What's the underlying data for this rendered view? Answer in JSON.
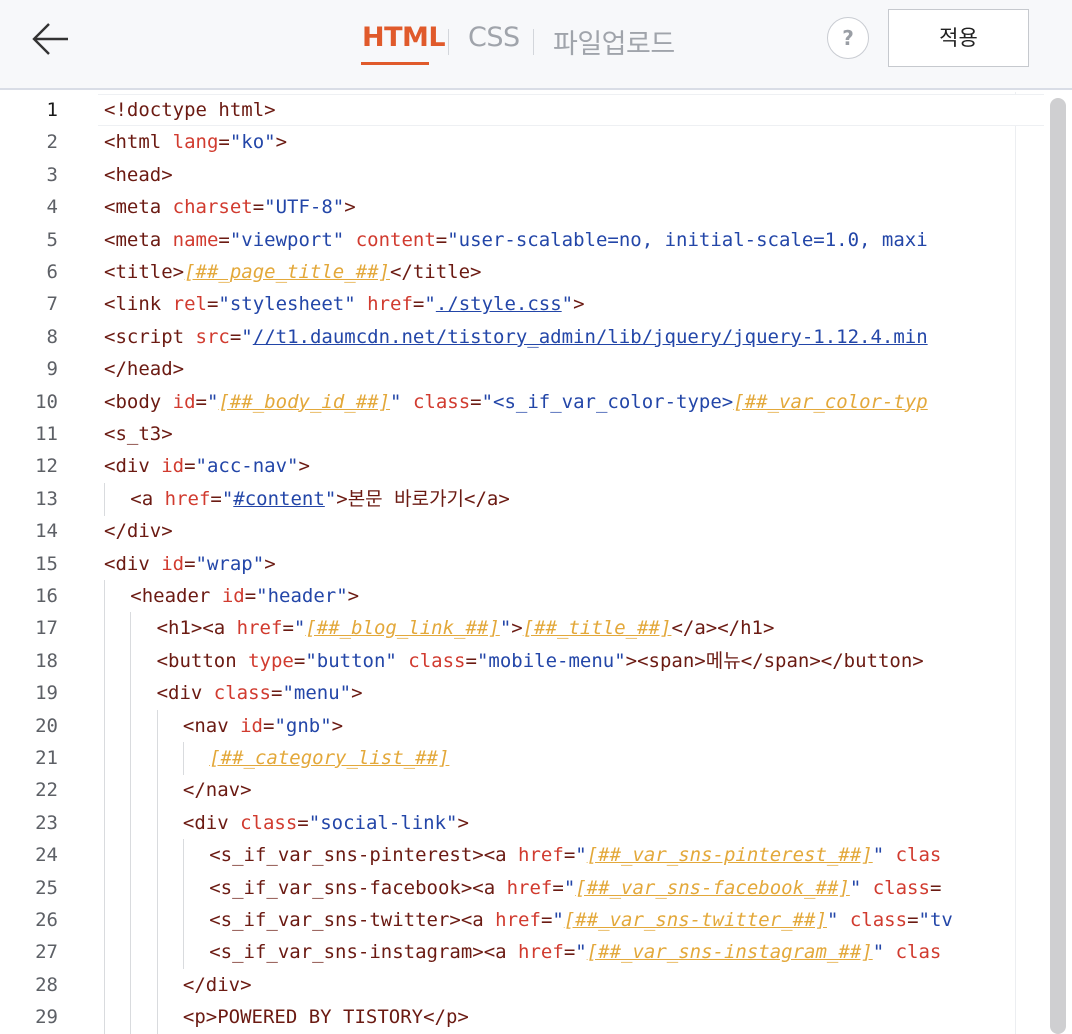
{
  "header": {
    "tabs": [
      {
        "label": "HTML",
        "active": true
      },
      {
        "label": "CSS",
        "active": false
      },
      {
        "label": "파일업로드",
        "active": false
      }
    ],
    "help_label": "?",
    "apply_label": "적용"
  },
  "colors": {
    "accent": "#e05a2b",
    "tag": "#6b1a12",
    "attr": "#d13b2f",
    "string": "#2346a8",
    "variable": "#e3a83a"
  },
  "editor": {
    "lines": [
      {
        "n": "1",
        "segs": [
          [
            "t",
            "<!doctype html>"
          ]
        ]
      },
      {
        "n": "2",
        "segs": [
          [
            "t",
            "<html "
          ],
          [
            "a",
            "lang"
          ],
          [
            "t",
            "="
          ],
          [
            "s",
            "\"ko\""
          ],
          [
            "t",
            ">"
          ]
        ]
      },
      {
        "n": "3",
        "segs": [
          [
            "t",
            "<head>"
          ]
        ]
      },
      {
        "n": "4",
        "segs": [
          [
            "t",
            "<meta "
          ],
          [
            "a",
            "charset"
          ],
          [
            "t",
            "="
          ],
          [
            "s",
            "\"UTF-8\""
          ],
          [
            "t",
            ">"
          ]
        ]
      },
      {
        "n": "5",
        "segs": [
          [
            "t",
            "<meta "
          ],
          [
            "a",
            "name"
          ],
          [
            "t",
            "="
          ],
          [
            "s",
            "\"viewport\""
          ],
          [
            "t",
            " "
          ],
          [
            "a",
            "content"
          ],
          [
            "t",
            "="
          ],
          [
            "s",
            "\"user-scalable=no, initial-scale=1.0, maxi"
          ]
        ]
      },
      {
        "n": "6",
        "segs": [
          [
            "t",
            "<title>"
          ],
          [
            "v",
            "[##_page_title_##]"
          ],
          [
            "t",
            "</title>"
          ]
        ]
      },
      {
        "n": "7",
        "segs": [
          [
            "t",
            "<link "
          ],
          [
            "a",
            "rel"
          ],
          [
            "t",
            "="
          ],
          [
            "s",
            "\"stylesheet\""
          ],
          [
            "t",
            " "
          ],
          [
            "a",
            "href"
          ],
          [
            "t",
            "="
          ],
          [
            "s",
            "\""
          ],
          [
            "lk",
            "./style.css"
          ],
          [
            "s",
            "\""
          ],
          [
            "t",
            ">"
          ]
        ]
      },
      {
        "n": "8",
        "segs": [
          [
            "t",
            "<script "
          ],
          [
            "a",
            "src"
          ],
          [
            "t",
            "="
          ],
          [
            "s",
            "\""
          ],
          [
            "lk",
            "//t1.daumcdn.net/tistory_admin/lib/jquery/jquery-1.12.4.min"
          ]
        ]
      },
      {
        "n": "9",
        "segs": [
          [
            "t",
            "</head>"
          ]
        ]
      },
      {
        "n": "10",
        "segs": [
          [
            "t",
            "<body "
          ],
          [
            "a",
            "id"
          ],
          [
            "t",
            "="
          ],
          [
            "s",
            "\""
          ],
          [
            "v",
            "[##_body_id_##]"
          ],
          [
            "s",
            "\""
          ],
          [
            "t",
            " "
          ],
          [
            "a",
            "class"
          ],
          [
            "t",
            "="
          ],
          [
            "s",
            "\"<s_if_var_color-type>"
          ],
          [
            "v",
            "[##_var_color-typ"
          ]
        ]
      },
      {
        "n": "11",
        "segs": [
          [
            "t",
            "<s_t3>"
          ]
        ]
      },
      {
        "n": "12",
        "segs": [
          [
            "t",
            "<div "
          ],
          [
            "a",
            "id"
          ],
          [
            "t",
            "="
          ],
          [
            "s",
            "\"acc-nav\""
          ],
          [
            "t",
            ">"
          ]
        ]
      },
      {
        "n": "13",
        "indent": 1,
        "segs": [
          [
            "t",
            "<a "
          ],
          [
            "a",
            "href"
          ],
          [
            "t",
            "="
          ],
          [
            "s",
            "\""
          ],
          [
            "lk",
            "#content"
          ],
          [
            "s",
            "\""
          ],
          [
            "t",
            ">본문 바로가기</a>"
          ]
        ]
      },
      {
        "n": "14",
        "segs": [
          [
            "t",
            "</div>"
          ]
        ]
      },
      {
        "n": "15",
        "segs": [
          [
            "t",
            "<div "
          ],
          [
            "a",
            "id"
          ],
          [
            "t",
            "="
          ],
          [
            "s",
            "\"wrap\""
          ],
          [
            "t",
            ">"
          ]
        ]
      },
      {
        "n": "16",
        "indent": 1,
        "segs": [
          [
            "t",
            "<header "
          ],
          [
            "a",
            "id"
          ],
          [
            "t",
            "="
          ],
          [
            "s",
            "\"header\""
          ],
          [
            "t",
            ">"
          ]
        ]
      },
      {
        "n": "17",
        "indent": 2,
        "segs": [
          [
            "t",
            "<h1><a "
          ],
          [
            "a",
            "href"
          ],
          [
            "t",
            "="
          ],
          [
            "s",
            "\""
          ],
          [
            "v",
            "[##_blog_link_##]"
          ],
          [
            "s",
            "\""
          ],
          [
            "t",
            ">"
          ],
          [
            "v",
            "[##_title_##]"
          ],
          [
            "t",
            "</a></h1>"
          ]
        ]
      },
      {
        "n": "18",
        "indent": 2,
        "segs": [
          [
            "t",
            "<button "
          ],
          [
            "a",
            "type"
          ],
          [
            "t",
            "="
          ],
          [
            "s",
            "\"button\""
          ],
          [
            "t",
            " "
          ],
          [
            "a",
            "class"
          ],
          [
            "t",
            "="
          ],
          [
            "s",
            "\"mobile-menu\""
          ],
          [
            "t",
            "><span>메뉴</span></button>"
          ]
        ]
      },
      {
        "n": "19",
        "indent": 2,
        "segs": [
          [
            "t",
            "<div "
          ],
          [
            "a",
            "class"
          ],
          [
            "t",
            "="
          ],
          [
            "s",
            "\"menu\""
          ],
          [
            "t",
            ">"
          ]
        ]
      },
      {
        "n": "20",
        "indent": 3,
        "segs": [
          [
            "t",
            "<nav "
          ],
          [
            "a",
            "id"
          ],
          [
            "t",
            "="
          ],
          [
            "s",
            "\"gnb\""
          ],
          [
            "t",
            ">"
          ]
        ]
      },
      {
        "n": "21",
        "indent": 4,
        "segs": [
          [
            "v",
            "[##_category_list_##]"
          ]
        ]
      },
      {
        "n": "22",
        "indent": 3,
        "segs": [
          [
            "t",
            "</nav>"
          ]
        ]
      },
      {
        "n": "23",
        "indent": 3,
        "segs": [
          [
            "t",
            "<div "
          ],
          [
            "a",
            "class"
          ],
          [
            "t",
            "="
          ],
          [
            "s",
            "\"social-link\""
          ],
          [
            "t",
            ">"
          ]
        ]
      },
      {
        "n": "24",
        "indent": 4,
        "segs": [
          [
            "t",
            "<s_if_var_sns-pinterest><a "
          ],
          [
            "a",
            "href"
          ],
          [
            "t",
            "="
          ],
          [
            "s",
            "\""
          ],
          [
            "v",
            "[##_var_sns-pinterest_##]"
          ],
          [
            "s",
            "\""
          ],
          [
            "t",
            " "
          ],
          [
            "a",
            "clas"
          ]
        ]
      },
      {
        "n": "25",
        "indent": 4,
        "segs": [
          [
            "t",
            "<s_if_var_sns-facebook><a "
          ],
          [
            "a",
            "href"
          ],
          [
            "t",
            "="
          ],
          [
            "s",
            "\""
          ],
          [
            "v",
            "[##_var_sns-facebook_##]"
          ],
          [
            "s",
            "\""
          ],
          [
            "t",
            " "
          ],
          [
            "a",
            "class"
          ],
          [
            "t",
            "="
          ]
        ]
      },
      {
        "n": "26",
        "indent": 4,
        "segs": [
          [
            "t",
            "<s_if_var_sns-twitter><a "
          ],
          [
            "a",
            "href"
          ],
          [
            "t",
            "="
          ],
          [
            "s",
            "\""
          ],
          [
            "v",
            "[##_var_sns-twitter_##]"
          ],
          [
            "s",
            "\""
          ],
          [
            "t",
            " "
          ],
          [
            "a",
            "class"
          ],
          [
            "t",
            "="
          ],
          [
            "s",
            "\"tv"
          ]
        ]
      },
      {
        "n": "27",
        "indent": 4,
        "segs": [
          [
            "t",
            "<s_if_var_sns-instagram><a "
          ],
          [
            "a",
            "href"
          ],
          [
            "t",
            "="
          ],
          [
            "s",
            "\""
          ],
          [
            "v",
            "[##_var_sns-instagram_##]"
          ],
          [
            "s",
            "\""
          ],
          [
            "t",
            " "
          ],
          [
            "a",
            "clas"
          ]
        ]
      },
      {
        "n": "28",
        "indent": 3,
        "segs": [
          [
            "t",
            "</div>"
          ]
        ]
      },
      {
        "n": "29",
        "indent": 3,
        "segs": [
          [
            "t",
            "<p>POWERED BY TISTORY</p>"
          ]
        ]
      }
    ]
  }
}
